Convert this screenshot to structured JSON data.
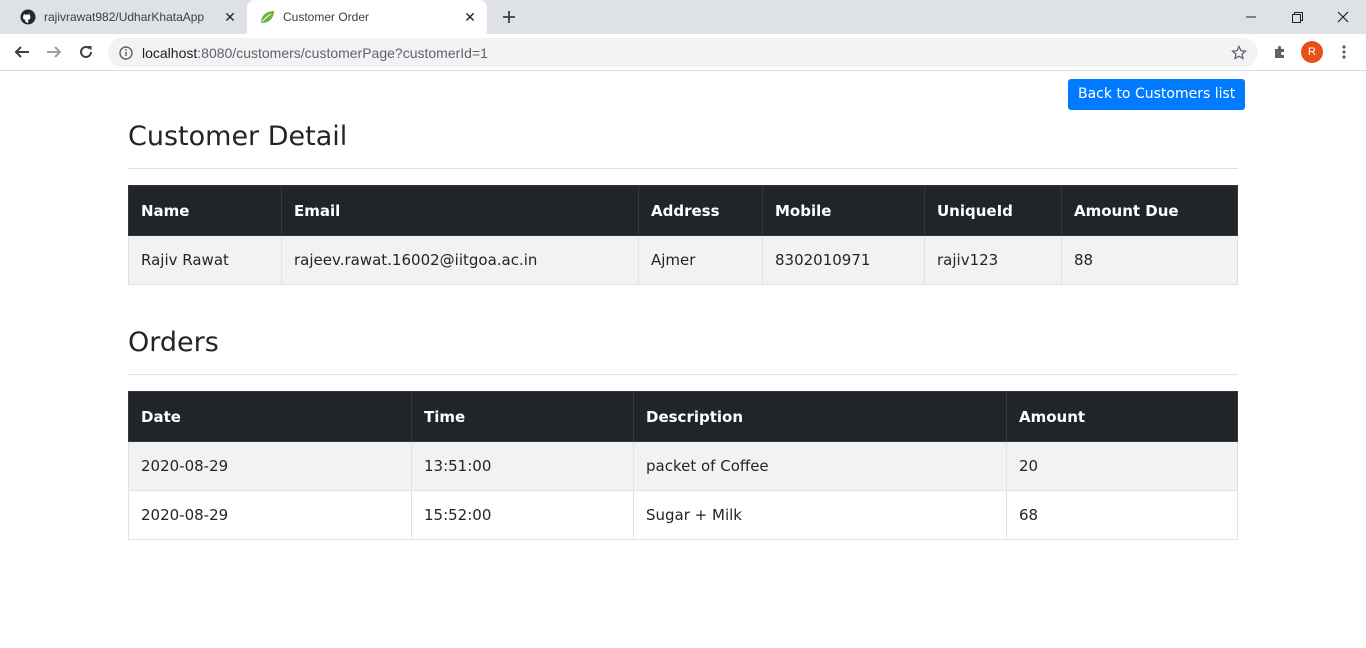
{
  "browser": {
    "tabs": [
      {
        "title": "rajivrawat982/UdharKhataApp"
      },
      {
        "title": "Customer Order"
      }
    ],
    "url_host": "localhost",
    "url_rest": ":8080/customers/customerPage?customerId=1",
    "profile_initial": "R"
  },
  "page": {
    "back_button_label": "Back to Customers list",
    "customer_section_title": "Customer Detail",
    "orders_section_title": "Orders",
    "customer_table": {
      "headers": [
        "Name",
        "Email",
        "Address",
        "Mobile",
        "UniqueId",
        "Amount Due"
      ],
      "rows": [
        [
          "Rajiv Rawat",
          "rajeev.rawat.16002@iitgoa.ac.in",
          "Ajmer",
          "8302010971",
          "rajiv123",
          "88"
        ]
      ]
    },
    "orders_table": {
      "headers": [
        "Date",
        "Time",
        "Description",
        "Amount"
      ],
      "rows": [
        [
          "2020-08-29",
          "13:51:00",
          "packet of Coffee",
          "20"
        ],
        [
          "2020-08-29",
          "15:52:00",
          "Sugar + Milk",
          "68"
        ]
      ]
    }
  },
  "colors": {
    "primary_button": "#007bff",
    "table_header": "#212529",
    "striped_row": "#f2f2f2",
    "avatar": "#e8501c"
  }
}
